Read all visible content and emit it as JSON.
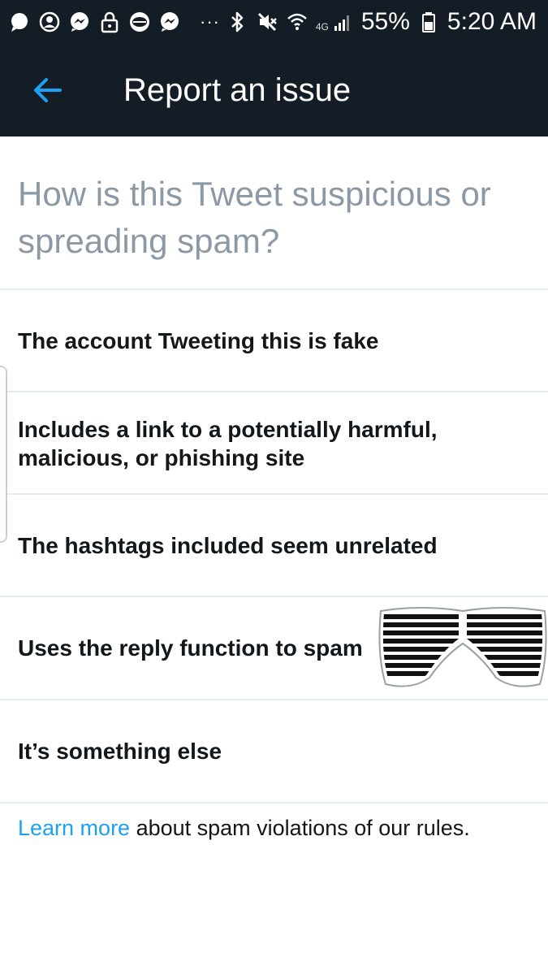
{
  "status_bar": {
    "left_icons": [
      "chat-bubble-icon",
      "account-circle-icon",
      "messenger-icon",
      "lock-icon",
      "burger-king-icon",
      "messenger-icon",
      "more-dots-icon"
    ],
    "right_icons": [
      "bluetooth-icon",
      "mute-icon",
      "wifi-icon",
      "network-type-icon",
      "signal-icon",
      "battery-icon"
    ],
    "network_type": "4G",
    "battery": "55%",
    "time": "5:20 AM"
  },
  "app_bar": {
    "back_icon": "arrow-left-icon",
    "title": "Report an issue"
  },
  "question": "How is this Tweet suspicious or spreading spam?",
  "options": [
    {
      "label": "The account Tweeting this is fake"
    },
    {
      "label": "Includes a link to a potentially harmful, malicious, or phishing site"
    },
    {
      "label": "The hashtags included seem unrelated"
    },
    {
      "label": "Uses the reply function to spam"
    },
    {
      "label": "It’s something else"
    }
  ],
  "footer": {
    "link_text": "Learn more",
    "text": " about spam violations of our rules."
  },
  "overlay_sticker": "shutter-shades-sticker",
  "colors": {
    "header_bg": "#141d26",
    "accent": "#1da1f2",
    "muted_text": "#8b98a5",
    "divider": "#e6ecf0"
  }
}
